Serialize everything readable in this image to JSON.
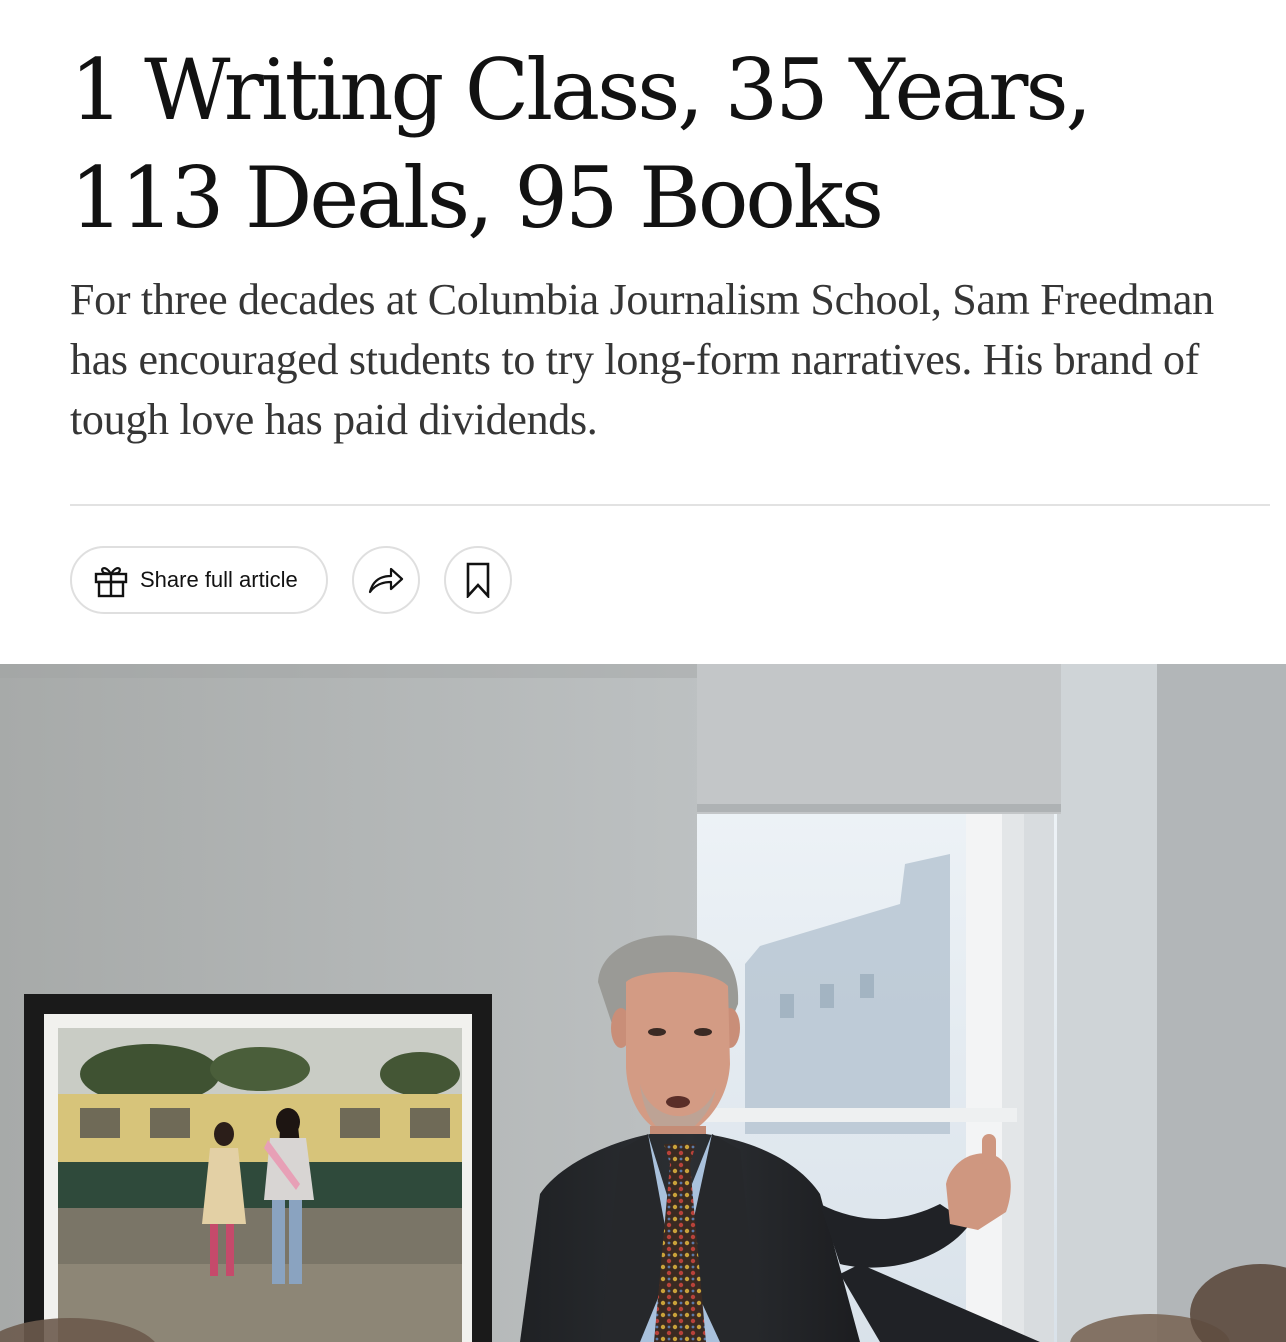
{
  "article": {
    "headline": "1 Writing Class, 35 Years, 113 Deals, 95 Books",
    "summary": "For three decades at Columbia Journalism School, Sam Freedman has encouraged students to try long-form narratives. His brand of tough love has paid dividends."
  },
  "share_bar": {
    "share_full_article_label": "Share full article",
    "gift_icon": "gift-icon",
    "share_icon": "share-arrow-icon",
    "save_icon": "bookmark-icon"
  },
  "colors": {
    "text": "#121212",
    "summary_text": "#363636",
    "border": "#dfdfdf"
  }
}
